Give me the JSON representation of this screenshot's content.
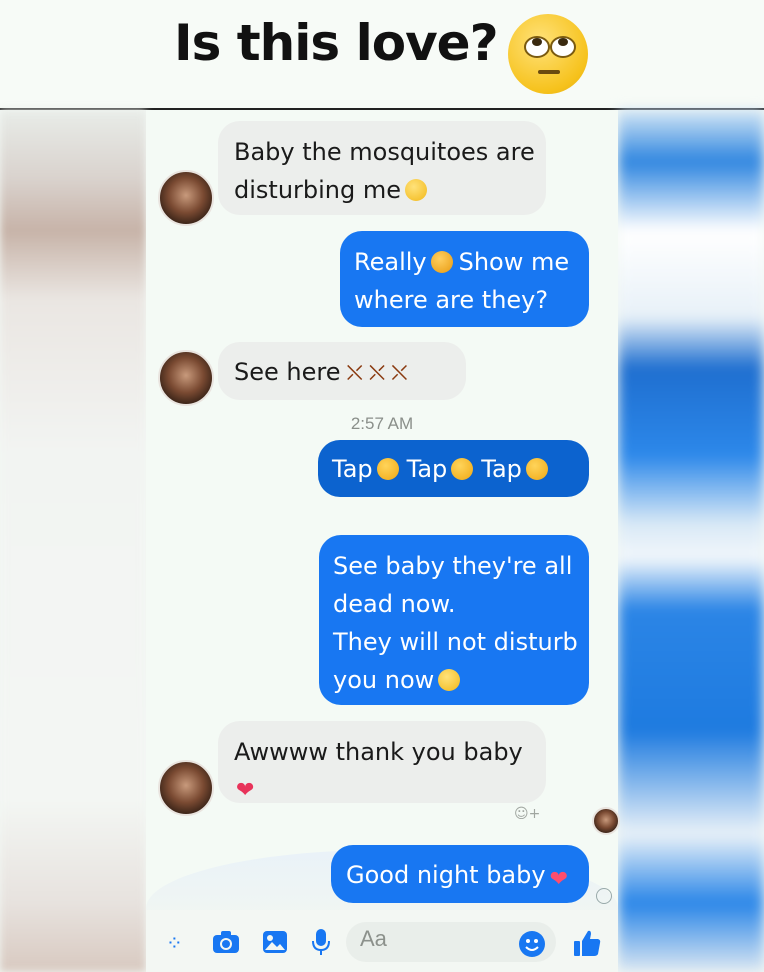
{
  "header": {
    "title": "Is this love?",
    "title_emoji": "face-with-rolling-eyes-icon"
  },
  "messages": [
    {
      "side": "incoming",
      "lines": [
        "Baby the mosquitoes are",
        "disturbing me"
      ],
      "trailing_icons": [
        "worried-face-icon"
      ]
    },
    {
      "side": "outgoing",
      "lines": [
        "Really",
        "Show me",
        "where are they?"
      ],
      "trailing_icons": [
        "pouting-face-icon"
      ]
    },
    {
      "side": "incoming",
      "lines": [
        "See here"
      ],
      "trailing_icons": [
        "mosquito-icon",
        "mosquito-icon",
        "mosquito-icon"
      ]
    },
    {
      "side": "outgoing",
      "lines": [
        "Tap",
        "Tap",
        "Tap"
      ],
      "trailing_icons": [
        "clapping-hands-icon"
      ]
    },
    {
      "side": "outgoing",
      "lines": [
        "See baby they're all",
        "dead now.",
        "They will not disturb",
        "you now"
      ],
      "trailing_icons": [
        "relieved-face-icon"
      ]
    },
    {
      "side": "incoming",
      "lines": [
        "Awwww thank you baby"
      ],
      "trailing_icons": [
        "sparkling-heart-icon"
      ]
    },
    {
      "side": "outgoing",
      "lines": [
        "Good night baby"
      ],
      "trailing_icons": [
        "sparkling-heart-icon"
      ]
    }
  ],
  "timestamp": "2:57 AM",
  "composer": {
    "placeholder": "Aa",
    "icons": [
      "menu-dots-icon",
      "camera-icon",
      "image-icon",
      "microphone-icon",
      "emoji-icon",
      "thumbs-up-icon"
    ]
  },
  "colors": {
    "outgoing_bubble": "#1877f2",
    "incoming_bubble": "#eceeec",
    "accent": "#1877f2"
  }
}
